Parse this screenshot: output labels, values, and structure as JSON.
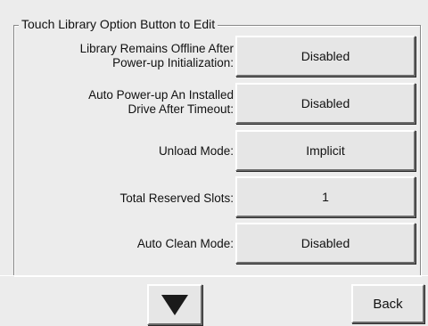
{
  "panel": {
    "title": "Touch Library Option Button to Edit"
  },
  "options": [
    {
      "label_line1": "Library Remains Offline After",
      "label_line2": "Power-up Initialization:",
      "value": "Disabled"
    },
    {
      "label_line1": "Auto Power-up An Installed",
      "label_line2": "Drive After Timeout:",
      "value": "Disabled"
    },
    {
      "label": "Unload Mode:",
      "value": "Implicit"
    },
    {
      "label": "Total Reserved Slots:",
      "value": "1"
    },
    {
      "label": "Auto Clean Mode:",
      "value": "Disabled"
    }
  ],
  "nav": {
    "down_icon": "down-triangle-icon",
    "back_label": "Back"
  },
  "colors": {
    "background": "#ececec",
    "button_face": "#e6e6e6",
    "icon": "#1a1a1a"
  }
}
